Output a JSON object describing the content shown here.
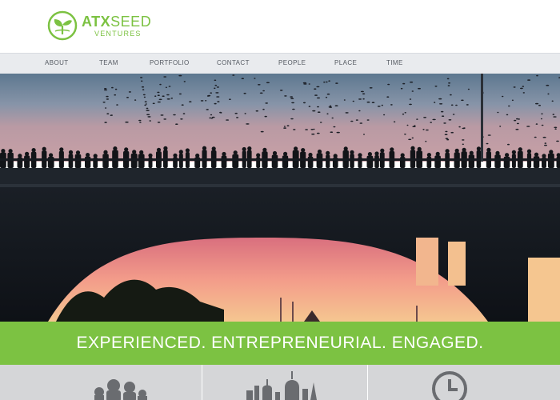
{
  "brand": {
    "logo_primary": "ATX",
    "logo_secondary": "SEED",
    "logo_sub": "VENTURES",
    "accent_color": "#7cc242",
    "logo_icon": "seedling-icon"
  },
  "nav": {
    "items": [
      {
        "label": "ABOUT"
      },
      {
        "label": "TEAM"
      },
      {
        "label": "PORTFOLIO"
      },
      {
        "label": "CONTACT"
      },
      {
        "label": "PEOPLE"
      },
      {
        "label": "PLACE"
      },
      {
        "label": "TIME"
      }
    ]
  },
  "hero": {
    "image": "congress-bridge-bats-at-sunset"
  },
  "tagline": {
    "text": "EXPERIENCED. ENTREPRENEURIAL. ENGAGED."
  },
  "panels": {
    "icons": [
      "people-icon",
      "skyline-icon",
      "clock-icon"
    ]
  }
}
